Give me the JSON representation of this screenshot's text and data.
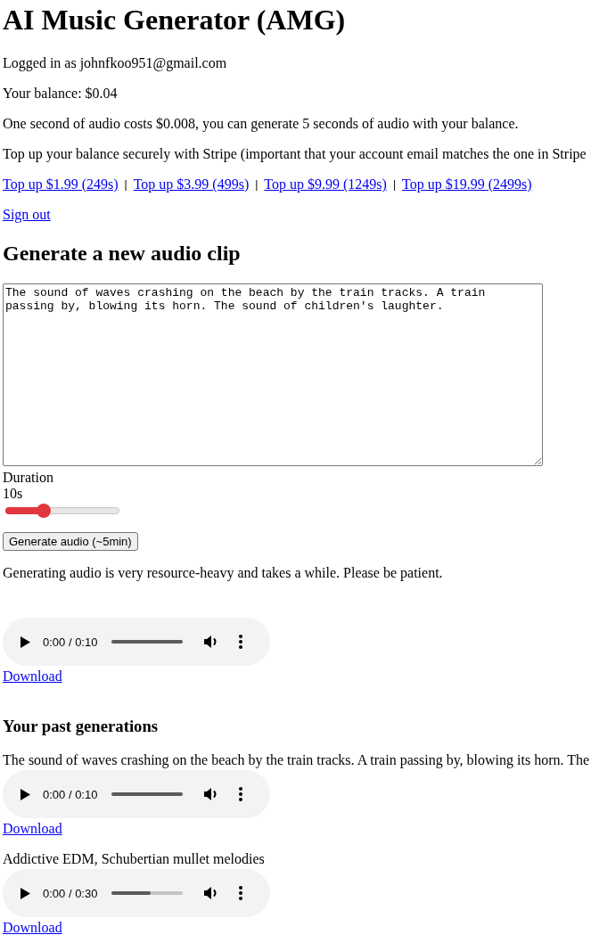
{
  "title": "AI Music Generator (AMG)",
  "account": {
    "logged_in": "Logged in as johnfkoo951@gmail.com",
    "balance": "Your balance: $0.04",
    "cost_note": "One second of audio costs $0.008, you can generate 5 seconds of audio with your balance.",
    "topup_note": "Top up your balance securely with Stripe (important that your account email matches the one in Stripe",
    "separator": "|",
    "topups": [
      "Top up $1.99 (249s)",
      "Top up $3.99 (499s)",
      "Top up $9.99 (1249s)",
      "Top up $19.99 (2499s)"
    ],
    "sign_out": "Sign out"
  },
  "generate": {
    "heading": "Generate a new audio clip",
    "prompt": "The sound of waves crashing on the beach by the train tracks. A train passing by, blowing its horn. The sound of children's laughter.",
    "duration_label": "Duration",
    "duration_value": "10s",
    "duration_slider": {
      "level": 0.33
    },
    "button": "Generate audio (~5min)",
    "note": "Generating audio is very resource-heavy and takes a while. Please be patient.",
    "result": {
      "time": "0:00 / 0:10",
      "level": 1,
      "download": "Download"
    }
  },
  "past": {
    "heading": "Your past generations",
    "items": [
      {
        "prompt": "The sound of waves crashing on the beach by the train tracks. A train passing by, blowing its horn. The",
        "time": "0:00 / 0:10",
        "level": 1,
        "download": "Download"
      },
      {
        "prompt": "Addictive EDM, Schubertian mullet melodies",
        "time": "0:00 / 0:30",
        "level": 0.55,
        "download": "Download"
      }
    ]
  }
}
